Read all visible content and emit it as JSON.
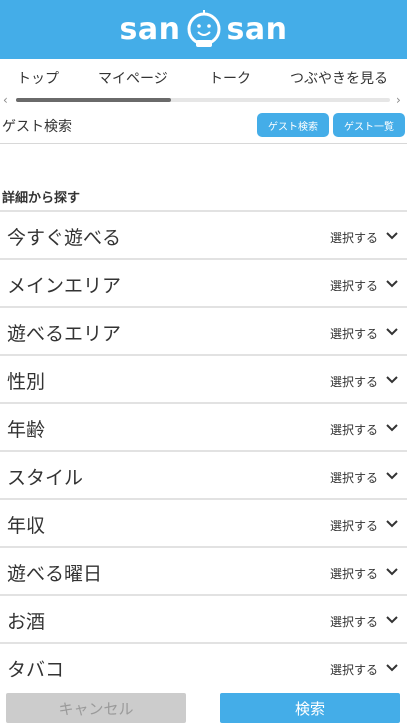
{
  "header": {
    "logo_left": "san",
    "logo_right": "san",
    "brand_color": "#44ade8"
  },
  "nav": {
    "items": [
      {
        "label": "トップ"
      },
      {
        "label": "マイページ"
      },
      {
        "label": "トーク"
      },
      {
        "label": "つぶやきを見る"
      }
    ],
    "scroll_left_icon": "chevron-left-icon",
    "scroll_right_icon": "chevron-right-icon",
    "scroll_left_glyph": "‹",
    "scroll_right_glyph": "›"
  },
  "guest": {
    "label": "ゲスト検索",
    "search_button": "ゲスト検索",
    "list_button": "ゲスト一覧"
  },
  "filters": {
    "title": "詳細から探す",
    "select_label": "選択する",
    "items": [
      {
        "label": "今すぐ遊べる"
      },
      {
        "label": "メインエリア"
      },
      {
        "label": "遊べるエリア"
      },
      {
        "label": "性別"
      },
      {
        "label": "年齢"
      },
      {
        "label": "スタイル"
      },
      {
        "label": "年収"
      },
      {
        "label": "遊べる曜日"
      },
      {
        "label": "お酒"
      },
      {
        "label": "タバコ"
      }
    ]
  },
  "footer": {
    "cancel_label": "キャンセル",
    "search_label": "検索"
  }
}
